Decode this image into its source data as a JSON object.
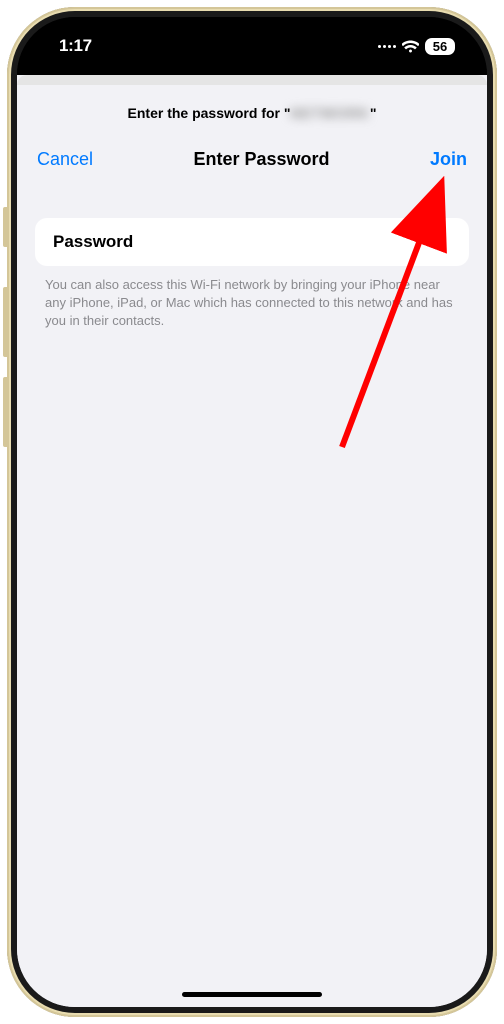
{
  "statusBar": {
    "time": "1:17",
    "batteryLevel": "56"
  },
  "prompt": {
    "prefix": "Enter the password for \"",
    "networkName": "NETWORK",
    "suffix": "\""
  },
  "navBar": {
    "cancel": "Cancel",
    "title": "Enter Password",
    "join": "Join"
  },
  "passwordField": {
    "label": "Password"
  },
  "helpText": "You can also access this Wi-Fi network by bringing your iPhone near any iPhone, iPad, or Mac which has connected to this network and has you in their contacts."
}
